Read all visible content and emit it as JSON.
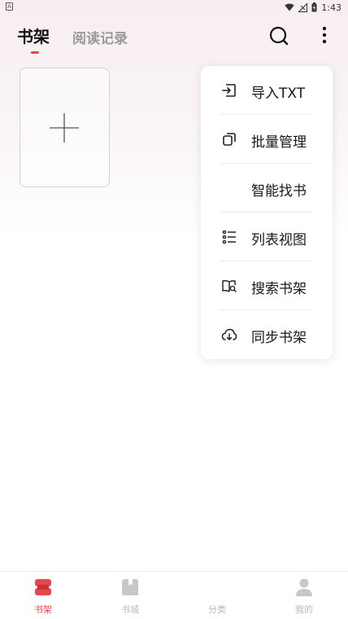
{
  "status_bar": {
    "time": "1:43",
    "battery_icon": "battery-charging-icon",
    "wifi_icon": "wifi-icon",
    "signal_icon": "signal-icon"
  },
  "header": {
    "tabs": [
      {
        "label": "书架",
        "active": true
      },
      {
        "label": "阅读记录",
        "active": false
      }
    ],
    "search_icon": "search-icon",
    "more_icon": "more-vertical-icon"
  },
  "shelf": {
    "add_icon": "plus-icon"
  },
  "menu": {
    "items": [
      {
        "label": "导入TXT",
        "icon": "import-icon"
      },
      {
        "label": "批量管理",
        "icon": "copy-icon"
      },
      {
        "label": "智能找书",
        "icon": ""
      },
      {
        "label": "列表视图",
        "icon": "list-icon"
      },
      {
        "label": "搜索书架",
        "icon": "book-search-icon"
      },
      {
        "label": "同步书架",
        "icon": "cloud-download-icon"
      }
    ]
  },
  "bottom_nav": {
    "items": [
      {
        "label": "书架",
        "icon": "shelf-icon",
        "active": true
      },
      {
        "label": "书城",
        "icon": "book-store-icon",
        "active": false
      },
      {
        "label": "分类",
        "icon": "",
        "active": false
      },
      {
        "label": "我的",
        "icon": "person-icon",
        "active": false
      }
    ]
  },
  "colors": {
    "accent": "#e7474c",
    "inactive": "#b8b8b8"
  }
}
